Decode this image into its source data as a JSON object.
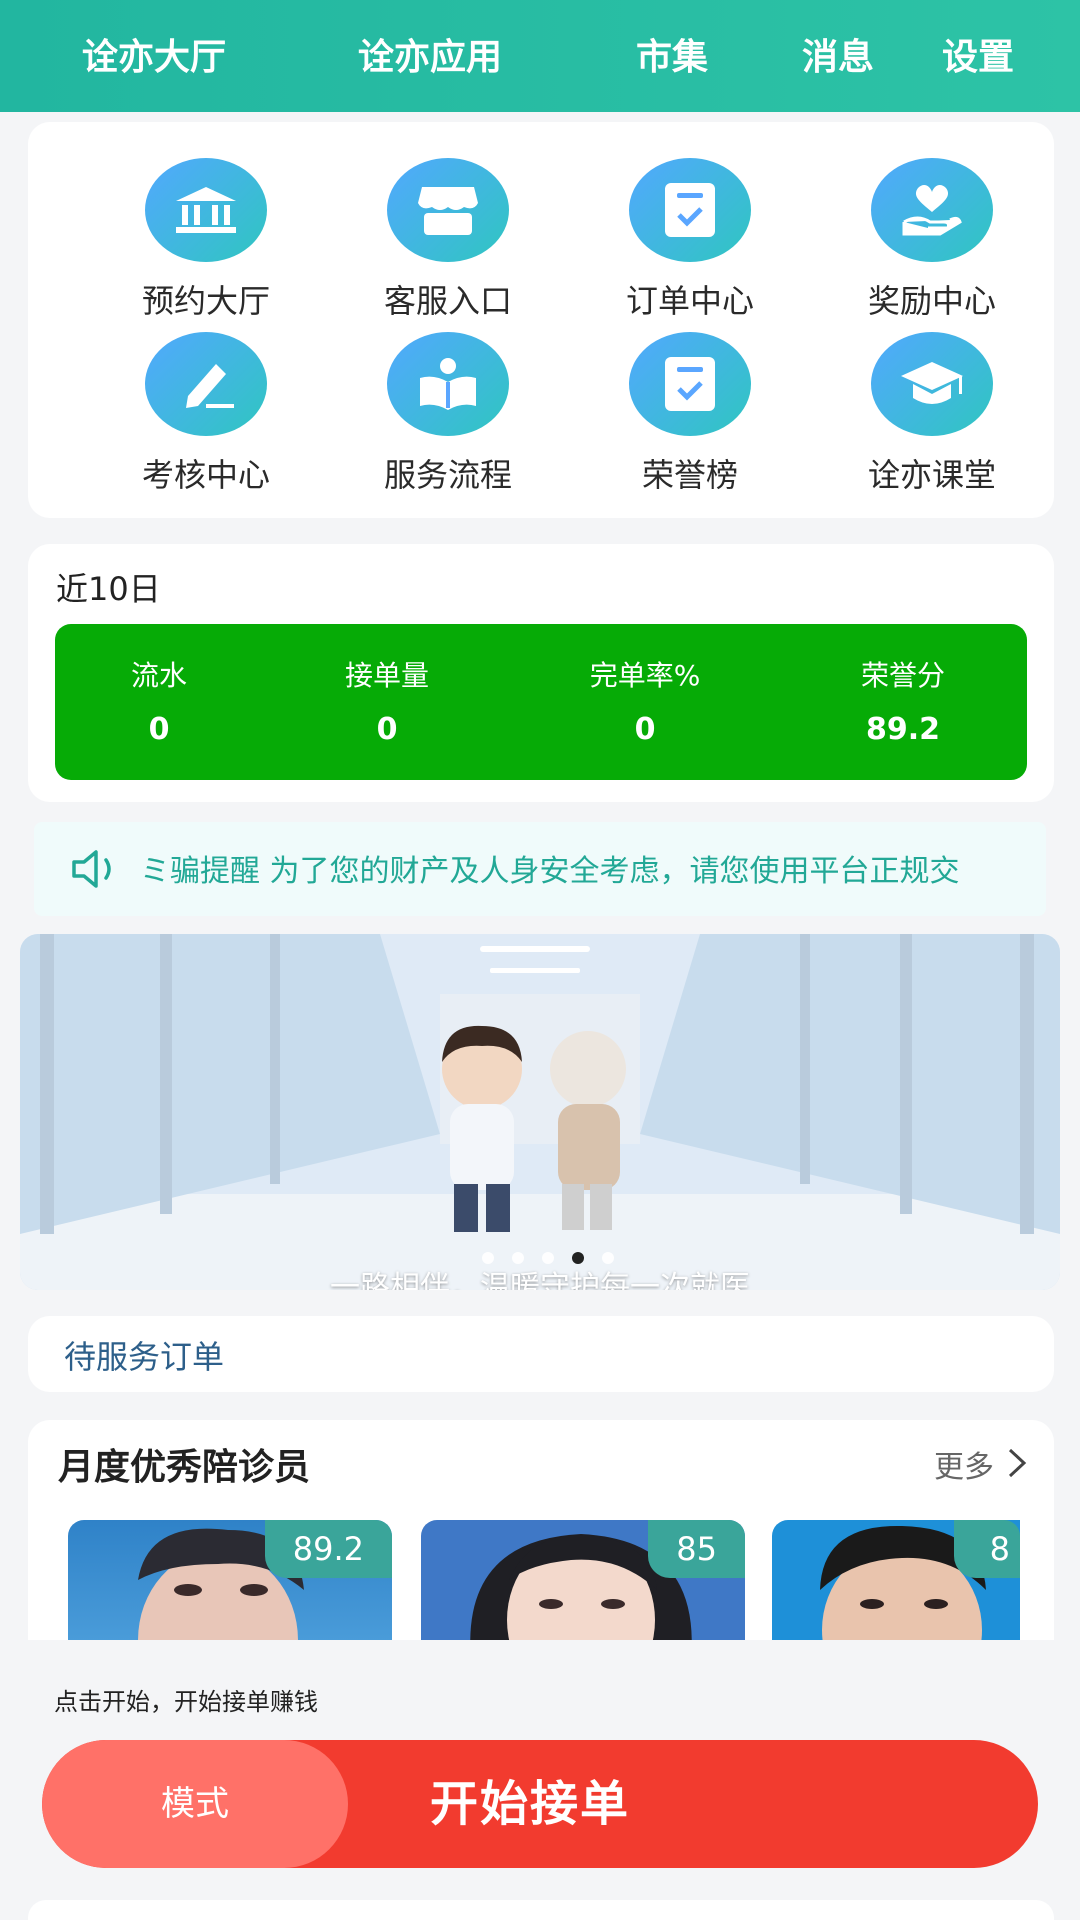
{
  "nav": {
    "tabs": [
      {
        "label": "诠亦大厅"
      },
      {
        "label": "诠亦应用"
      },
      {
        "label": "市集"
      },
      {
        "label": "消息"
      },
      {
        "label": "设置"
      }
    ]
  },
  "grid": {
    "items": [
      {
        "label": "预约大厅",
        "icon": "building-icon"
      },
      {
        "label": "客服入口",
        "icon": "store-icon"
      },
      {
        "label": "订单中心",
        "icon": "checklist-icon"
      },
      {
        "label": "奖励中心",
        "icon": "heart-hand-icon"
      },
      {
        "label": "考核中心",
        "icon": "pencil-icon"
      },
      {
        "label": "服务流程",
        "icon": "reading-person-icon"
      },
      {
        "label": "荣誉榜",
        "icon": "checklist-icon"
      },
      {
        "label": "诠亦课堂",
        "icon": "graduation-cap-icon"
      }
    ]
  },
  "stats": {
    "title": "近10日",
    "items": [
      {
        "label": "流水",
        "value": "0"
      },
      {
        "label": "接单量",
        "value": "0"
      },
      {
        "label": "完单率%",
        "value": "0"
      },
      {
        "label": "荣誉分",
        "value": "89.2"
      }
    ]
  },
  "notice": {
    "text": "ミ骗提醒 为了您的财产及人身安全考虑，请您使用平台正规交"
  },
  "banner": {
    "caption": "一路相伴，温暖守护每一次就医",
    "slide_count": 5,
    "active_slide": 4
  },
  "pending": {
    "label": "待服务订单"
  },
  "excellent": {
    "title": "月度优秀陪诊员",
    "more_label": "更多",
    "people": [
      {
        "score": "89.2"
      },
      {
        "score": "85"
      },
      {
        "score": "8"
      }
    ]
  },
  "hint": "点击开始，开始接单赚钱",
  "action": {
    "mode_label": "模式",
    "start_label": "开始接单"
  },
  "colors": {
    "nav": "#22b6a0",
    "stats_bg": "#06ab06",
    "start": "#f23b2f",
    "mode": "#ff7168",
    "score_badge": "#3aa59a"
  }
}
